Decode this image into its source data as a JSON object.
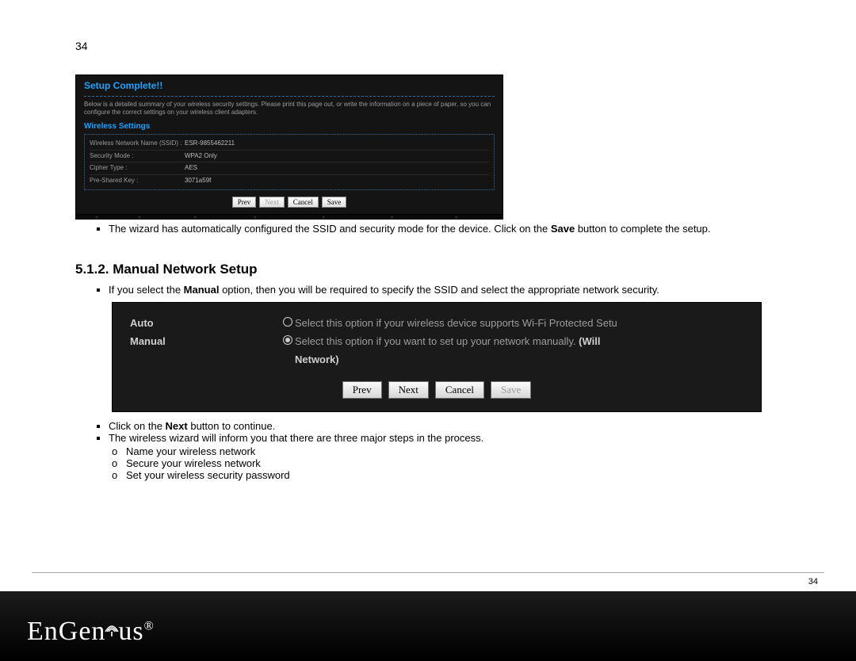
{
  "page_number_top": "34",
  "setup_complete": {
    "title": "Setup Complete!!",
    "intro": "Below is a detailed summary of your wireless security settings. Please print this page out, or write the information on a piece of paper, so you can configure the correct settings on your wireless client adapters.",
    "subtitle": "Wireless Settings",
    "rows": [
      {
        "k": "Wireless Network Name (SSID) :",
        "v": "ESR-9855462211"
      },
      {
        "k": "Security Mode :",
        "v": "WPA2 Only"
      },
      {
        "k": "Cipher Type :",
        "v": "AES"
      },
      {
        "k": "Pre-Shared Key :",
        "v": "3071a59f"
      }
    ],
    "buttons": {
      "prev": "Prev",
      "next": "Next",
      "cancel": "Cancel",
      "save": "Save"
    }
  },
  "bullet_after_sc": {
    "pre": "The wizard has automatically configured the SSID and security mode for the device. Click on the ",
    "bold": "Save",
    "post": " button to complete the setup."
  },
  "section_heading": "5.1.2. Manual Network Setup",
  "bullet_manual": {
    "pre": "If you select the ",
    "bold": "Manual",
    "post": " option, then you will be required to specify the SSID and select the appropriate network security."
  },
  "choice_panel": {
    "auto": {
      "label": "Auto",
      "desc": "Select this option if your wireless device supports Wi-Fi Protected Setu"
    },
    "manual": {
      "label": "Manual",
      "desc_pre": "Select this option if you want to set up your network manually. ",
      "desc_bold1": "(Will ",
      "desc_bold2": "Network)"
    },
    "buttons": {
      "prev": "Prev",
      "next": "Next",
      "cancel": "Cancel",
      "save": "Save"
    }
  },
  "after_bullets": {
    "b1_pre": "Click on the ",
    "b1_bold": "Next",
    "b1_post": " button to continue.",
    "b2": "The wireless wizard will inform you that there are three major steps in the process.",
    "sub": [
      "Name your wireless network",
      "Secure your wireless network",
      "Set your wireless security password"
    ]
  },
  "footer": {
    "page_number": "34",
    "brand": "EnGenius"
  }
}
